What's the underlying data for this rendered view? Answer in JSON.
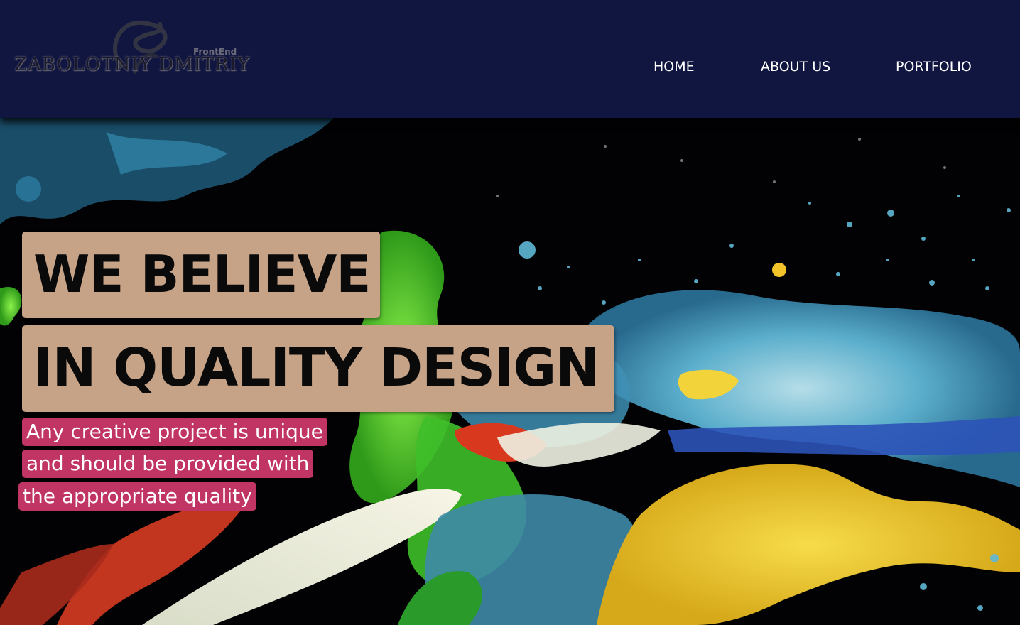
{
  "header": {
    "logo": {
      "name": "ZABOLOTNIY DMITRIY",
      "sub": "FrontEnd"
    },
    "nav": [
      {
        "label": "HOME"
      },
      {
        "label": "ABOUT US"
      },
      {
        "label": "PORTFOLIO"
      }
    ]
  },
  "hero": {
    "headline_line1": "WE BELIEVE",
    "headline_line2": "IN QUALITY DESIGN",
    "sub_lines": [
      "Any creative project is unique",
      "and should be provided with",
      "the appropriate quality"
    ],
    "background": "paint-splash-image"
  },
  "colors": {
    "header_bg": "#111641",
    "headline_box": "#c6a287",
    "sub_box": "#c03563",
    "nav_text": "#ffffff"
  }
}
